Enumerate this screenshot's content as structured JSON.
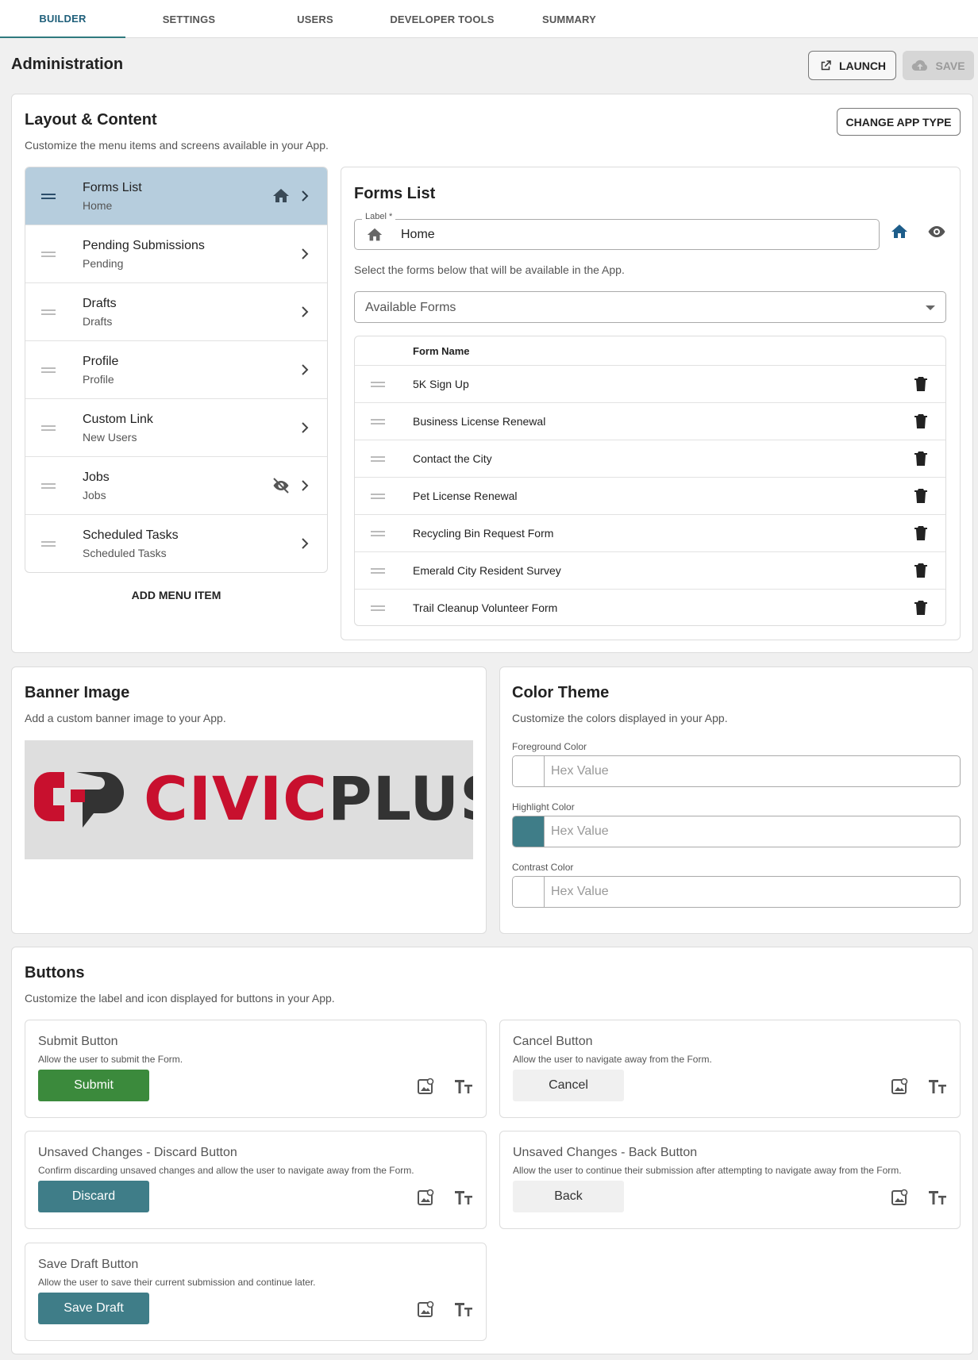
{
  "tabs": [
    {
      "label": "BUILDER",
      "active": true
    },
    {
      "label": "SETTINGS"
    },
    {
      "label": "USERS"
    },
    {
      "label": "DEVELOPER TOOLS"
    },
    {
      "label": "SUMMARY"
    }
  ],
  "header": {
    "title": "Administration",
    "launch_label": "LAUNCH",
    "save_label": "SAVE"
  },
  "layout": {
    "title": "Layout & Content",
    "subtitle": "Customize the menu items and screens available in your App.",
    "change_app_type": "CHANGE APP TYPE",
    "add_menu_item": "ADD MENU ITEM",
    "menu_items": [
      {
        "title": "Forms List",
        "subtitle": "Home",
        "selected": true,
        "icon": "home-icon"
      },
      {
        "title": "Pending Submissions",
        "subtitle": "Pending"
      },
      {
        "title": "Drafts",
        "subtitle": "Drafts"
      },
      {
        "title": "Profile",
        "subtitle": "Profile"
      },
      {
        "title": "Custom Link",
        "subtitle": "New Users"
      },
      {
        "title": "Jobs",
        "subtitle": "Jobs",
        "icon": "eye-off-icon"
      },
      {
        "title": "Scheduled Tasks",
        "subtitle": "Scheduled Tasks"
      }
    ]
  },
  "forms_list": {
    "title": "Forms List",
    "label_legend": "Label *",
    "label_value": "Home",
    "description": "Select the forms below that will be available in the App.",
    "available_forms": "Available Forms",
    "column_header": "Form Name",
    "forms": [
      "5K Sign Up",
      "Business License Renewal",
      "Contact the City",
      "Pet License Renewal",
      "Recycling Bin Request Form",
      "Emerald City Resident Survey",
      "Trail Cleanup Volunteer Form"
    ]
  },
  "banner": {
    "title": "Banner Image",
    "subtitle": "Add a custom banner image to your App.",
    "logo_text_red": "CIVIC",
    "logo_text_dark": "PLUS"
  },
  "color_theme": {
    "title": "Color Theme",
    "subtitle": "Customize the colors displayed in your App.",
    "fields": [
      {
        "label": "Foreground Color",
        "placeholder": "Hex Value",
        "swatch": "#ffffff"
      },
      {
        "label": "Highlight Color",
        "placeholder": "Hex Value",
        "swatch": "#3f7d88"
      },
      {
        "label": "Contrast Color",
        "placeholder": "Hex Value",
        "swatch": "#ffffff"
      }
    ]
  },
  "buttons": {
    "title": "Buttons",
    "subtitle": "Customize the label and icon displayed for buttons in your App.",
    "items": [
      {
        "title": "Submit Button",
        "desc": "Allow the user to submit the Form.",
        "label": "Submit",
        "bg": "#3b8a3c",
        "fg": "#ffffff"
      },
      {
        "title": "Cancel Button",
        "desc": "Allow the user to navigate away from the Form.",
        "label": "Cancel",
        "bg": "#f0f0f0",
        "fg": "#333333"
      },
      {
        "title": "Unsaved Changes - Discard Button",
        "desc": "Confirm discarding unsaved changes and allow the user to navigate away from the Form.",
        "label": "Discard",
        "bg": "#3f7d88",
        "fg": "#ffffff"
      },
      {
        "title": "Unsaved Changes - Back Button",
        "desc": "Allow the user to continue their submission after attempting to navigate away from the Form.",
        "label": "Back",
        "bg": "#f0f0f0",
        "fg": "#333333"
      },
      {
        "title": "Save Draft Button",
        "desc": "Allow the user to save their current submission and continue later.",
        "label": "Save Draft",
        "bg": "#3f7d88",
        "fg": "#ffffff"
      }
    ]
  },
  "colors": {
    "accent": "#2f7a7e",
    "brand_red": "#c8102e",
    "brand_dark": "#333333"
  }
}
